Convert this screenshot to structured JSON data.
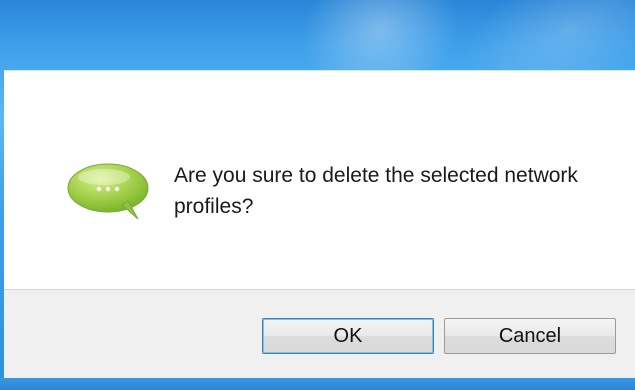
{
  "dialog": {
    "message": "Are you sure to delete the selected network profiles?",
    "icon": "speech-bubble-icon",
    "ok_label": "OK",
    "cancel_label": "Cancel"
  },
  "colors": {
    "frame_blue": "#3fa0ea",
    "icon_green": "#8cc63f",
    "footer_gray": "#f0f0f0"
  }
}
